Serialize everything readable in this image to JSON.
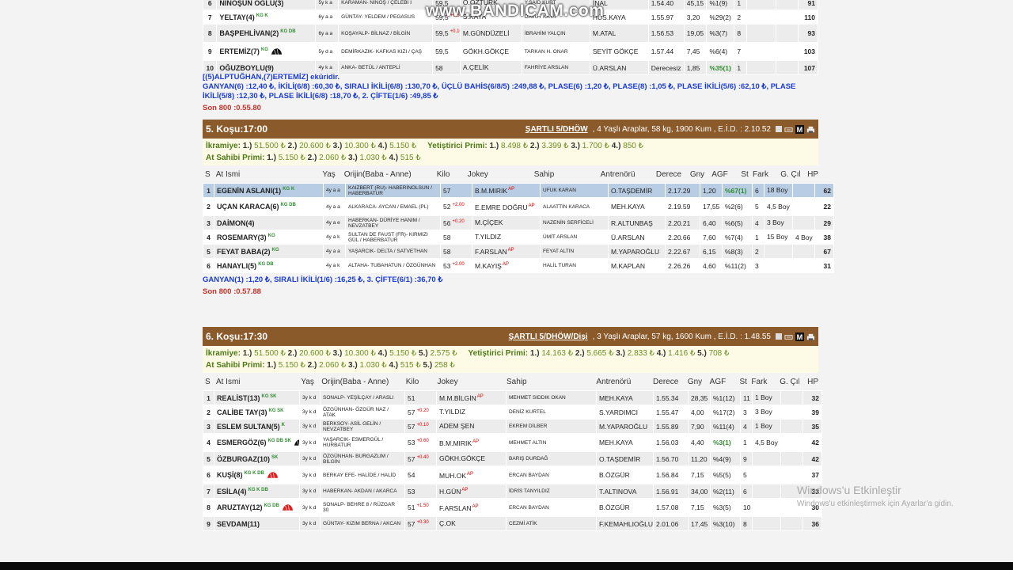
{
  "watermark": "www.BANDICAM.com",
  "race4": {
    "rows": [
      {
        "s": "6",
        "name": "NİNOŞUN OĞLU(3)",
        "badge": "",
        "age": "5y k a",
        "origin": "KARAMAN- NİNOŞ / ÇELEBİ I",
        "kilo": "59,5",
        "kd": "",
        "jockey": "O.ÖZTÜRK",
        "ap": "",
        "owner": "Y.SAİD KURT",
        "trainer": "İNAL",
        "derece": "1.54.40",
        "gny": "45,15",
        "agf": "%1(9)",
        "st": "1",
        "fark": "",
        "gck": "",
        "hp": "91",
        "gear": ""
      },
      {
        "s": "7",
        "name": "YELTAY(4)",
        "badge": "KG K",
        "age": "6y a a",
        "origin": "GÜNTAY- YELDEM / PEGASUS",
        "kilo": "59,5",
        "kd": "+0.60",
        "jockey": "S.KAYA",
        "ap": "",
        "owner": "DAVUT KAYA",
        "trainer": "HÜS.KAYA",
        "derece": "1.55.97",
        "gny": "3,20",
        "agf": "%29(2)",
        "st": "2",
        "fark": "",
        "gck": "",
        "hp": "110",
        "gear": ""
      },
      {
        "s": "8",
        "name": "BAŞPEHLİVAN(2)",
        "badge": "KG DB",
        "age": "6y a a",
        "origin": "KOŞAYALP- BİLNAZ / BİLGİN",
        "kilo": "59,5",
        "kd": "+0.10",
        "jockey": "M.GÜNDÜZELİ",
        "ap": "",
        "owner": "İBRAHİM YALÇIN",
        "trainer": "M.ATAL",
        "derece": "1.56.53",
        "gny": "19,05",
        "agf": "%3(7)",
        "st": "8",
        "fark": "",
        "gck": "",
        "hp": "93",
        "gear": ""
      },
      {
        "s": "9",
        "name": "ERTEMİZ(7)",
        "badge": "KG",
        "age": "5y d a",
        "origin": "DEMİRKAZIK- KAFKAS KIZI / ÇAŞ",
        "kilo": "59,5",
        "kd": "",
        "jockey": "GÖKH.GÖKÇE",
        "ap": "",
        "owner": "TARKAN H. ONAR",
        "trainer": "SEYİT GÖKÇE",
        "derece": "1.57.44",
        "gny": "7,45",
        "agf": "%6(4)",
        "st": "7",
        "fark": "",
        "gck": "",
        "hp": "103",
        "gear": "black"
      },
      {
        "s": "10",
        "name": "OĞUZBOYLU(9)",
        "badge": "",
        "age": "4y k a",
        "origin": "ANKA- BETÜL / ANTEPLİ",
        "kilo": "58",
        "kd": "",
        "jockey": "A.ÇELİK",
        "ap": "",
        "owner": "FAHRİYE ARSLAN",
        "trainer": "Ü.ARSLAN",
        "derece": "Derecesiz",
        "gny": "1,85",
        "agf": "%35(1)",
        "st": "1",
        "fark": "",
        "gck": "",
        "hp": "107",
        "gear": ""
      }
    ],
    "note": "[(5)ALPTUĞHAN,(7)ERTEMİZ] eküridir.",
    "payout": "GANYAN(6) :12,40 ₺, İKİLİ(6/8) :60,30 ₺, SIRALI İKİLİ(6/8) :130,70 ₺, ÜÇLÜ BAHİS(6/8/5) :249,88 ₺, PLASE(6) :1,20 ₺, PLASE(8) :1,05 ₺, PLASE İKİLİ(5/6) :62,10 ₺, PLASE İKİLİ(5/8) :12,30 ₺, PLASE İKİLİ(6/8) :18,70 ₺, 2. ÇİFTE(1/6) :49,85 ₺",
    "son800": "Son 800 :0.55.80"
  },
  "race5": {
    "title": "5. Koşu:17:00",
    "cond": "ŞARTLI 5/DHÖW",
    "desc": ", 4 Yaşlı Araplar, 58 kg, 1900 Kum , E.İ.D. : 2.10.52",
    "ikramiye_label": "İkramiye:",
    "ikramiye": [
      "1.) 51.500 ₺",
      "2.) 20.600 ₺",
      "3.) 10.300 ₺",
      "4.) 5.150 ₺"
    ],
    "yetistirici_label": "Yetiştirici Primi:",
    "yetistirici": [
      "1.) 8.498 ₺",
      "2.) 3.399 ₺",
      "3.) 1.700 ₺",
      "4.) 850 ₺"
    ],
    "atsahibi_label": "At Sahibi Primi:",
    "atsahibi": [
      "1.) 5.150 ₺",
      "2.) 2.060 ₺",
      "3.) 1.030 ₺",
      "4.) 515 ₺"
    ],
    "rows": [
      {
        "s": "1",
        "name": "EGENİN ASLANI(1)",
        "badge": "KG K",
        "age": "4y a a",
        "origin": "KAIZBERT (RU)- HABERİNOLSUN / HABERBATUR",
        "kilo": "57",
        "kd": "",
        "jockey": "B.M.MIRIK",
        "ap": "AP",
        "owner": "UFUK KARAN",
        "trainer": "O.TAŞDEMİR",
        "derece": "2.17.29",
        "gny": "1,20",
        "agf": "%67(1)",
        "st": "6",
        "fark": "18 Boy",
        "gck": "",
        "hp": "62",
        "gear": ""
      },
      {
        "s": "2",
        "name": "UÇAN KARACA(6)",
        "badge": "KG DB",
        "age": "4y a a",
        "origin": "ALKARACA- AYCAN / EMAEL (PL)",
        "kilo": "52",
        "kd": "+2.00",
        "jockey": "E.EMRE DOĞRU",
        "ap": "AP",
        "owner": "ALAATTİN KARACA",
        "trainer": "MEH.KAYA",
        "derece": "2.19.59",
        "gny": "17,55",
        "agf": "%2(6)",
        "st": "5",
        "fark": "4,5 Boy",
        "gck": "",
        "hp": "22",
        "gear": ""
      },
      {
        "s": "3",
        "name": "DAİMON(4)",
        "badge": "",
        "age": "4y a e",
        "origin": "HABERKAN- DÜRİYE HANIM / NEVZATBEY",
        "kilo": "56",
        "kd": "+0.20",
        "jockey": "M.ÇİÇEK",
        "ap": "",
        "owner": "NAZENİN SERFİCELİ",
        "trainer": "R.ALTUNBAŞ",
        "derece": "2.20.21",
        "gny": "6,40",
        "agf": "%6(5)",
        "st": "4",
        "fark": "3 Boy",
        "gck": "",
        "hp": "29",
        "gear": ""
      },
      {
        "s": "4",
        "name": "ROSEMARY(3)",
        "badge": "KG",
        "age": "4y a k",
        "origin": "SULTAN DE FAUST (FR)- KIRMIZI GÜL / HABERBATUR",
        "kilo": "58",
        "kd": "",
        "jockey": "T.YILDIZ",
        "ap": "",
        "owner": "ÜMİT ARSLAN",
        "trainer": "Ü.ARSLAN",
        "derece": "2.20.66",
        "gny": "7,60",
        "agf": "%7(4)",
        "st": "1",
        "fark": "15 Boy",
        "gck": "4 Boy",
        "hp": "38",
        "gear": ""
      },
      {
        "s": "5",
        "name": "FEYAT BABA(2)",
        "badge": "KG",
        "age": "4y a a",
        "origin": "YAŞARCIK- DELTA / SATVETHAN",
        "kilo": "58",
        "kd": "",
        "jockey": "F.ARSLAN",
        "ap": "AP",
        "owner": "FEYAT ALTIN",
        "trainer": "M.YAPAROĞLU",
        "derece": "2.22.67",
        "gny": "6,15",
        "agf": "%8(3)",
        "st": "2",
        "fark": "",
        "gck": "",
        "hp": "67",
        "gear": ""
      },
      {
        "s": "6",
        "name": "HANAYLI(5)",
        "badge": "KG DB",
        "age": "4y a k",
        "origin": "ALTAHA- TUBAHATUN / ÖZGÜNHAN",
        "kilo": "53",
        "kd": "+2.00",
        "jockey": "M.KAYIŞ",
        "ap": "AP",
        "owner": "HALİL TURAN",
        "trainer": "M.KAPLAN",
        "derece": "2.26.26",
        "gny": "4,60",
        "agf": "%11(2)",
        "st": "3",
        "fark": "",
        "gck": "",
        "hp": "31",
        "gear": ""
      }
    ],
    "payout": "GANYAN(1) :1,20 ₺, SIRALI İKİLİ(1/6) :16,25 ₺, 3. ÇİFTE(6/1) :36,70 ₺",
    "son800": "Son 800 :0.57.88"
  },
  "race6": {
    "title": "6. Koşu:17:30",
    "cond": "ŞARTLI 5/DHÖW/Dişi",
    "desc": ", 3 Yaşlı Araplar, 57 kg, 1600 Kum , E.İ.D. : 1.48.55",
    "ikramiye_label": "İkramiye:",
    "ikramiye": [
      "1.) 51.500 ₺",
      "2.) 20.600 ₺",
      "3.) 10.300 ₺",
      "4.) 5.150 ₺",
      "5.) 2.575 ₺"
    ],
    "yetistirici_label": "Yetiştirici Primi:",
    "yetistirici": [
      "1.) 14.163 ₺",
      "2.) 5.665 ₺",
      "3.) 2.833 ₺",
      "4.) 1.416 ₺",
      "5.) 708 ₺"
    ],
    "atsahibi_label": "At Sahibi Primi:",
    "atsahibi": [
      "1.) 5.150 ₺",
      "2.) 2.060 ₺",
      "3.) 1.030 ₺",
      "4.) 515 ₺",
      "5.) 258 ₺"
    ],
    "rows": [
      {
        "s": "1",
        "name": "REALİST(13)",
        "badge": "KG SK",
        "age": "3y k d",
        "origin": "SONALP- YEŞİLÇAY / ARASLI",
        "kilo": "51",
        "kd": "",
        "jockey": "M.M.BİLGİN",
        "ap": "AP",
        "owner": "MEHMET SIDDIK OKAN",
        "trainer": "MEH.KAYA",
        "derece": "1.55.34",
        "gny": "28,35",
        "agf": "%1(12)",
        "st": "11",
        "fark": "1 Boy",
        "gck": "",
        "hp": "32",
        "gear": ""
      },
      {
        "s": "2",
        "name": "CALİBE TAY(3)",
        "badge": "KG SK",
        "age": "3y k d",
        "origin": "ÖZGÜNHAN- ÖZGÜR NAZ / ATAK",
        "kilo": "57",
        "kd": "+0.20",
        "jockey": "T.YILDIZ",
        "ap": "",
        "owner": "DENİZ KURTEL",
        "trainer": "S.YARDIMCI",
        "derece": "1.55.47",
        "gny": "4,00",
        "agf": "%17(2)",
        "st": "3",
        "fark": "3 Boy",
        "gck": "",
        "hp": "39",
        "gear": ""
      },
      {
        "s": "3",
        "name": "ESLEM SULTAN(5)",
        "badge": "K",
        "age": "3y k d",
        "origin": "BERKSOY- ASİL GELİN / NEVZATBEY",
        "kilo": "57",
        "kd": "+0.10",
        "jockey": "ADEM ŞEN",
        "ap": "",
        "owner": "EKREM DİLBER",
        "trainer": "M.YAPAROĞLU",
        "derece": "1.55.89",
        "gny": "7,90",
        "agf": "%11(4)",
        "st": "4",
        "fark": "1 Boy",
        "gck": "",
        "hp": "35",
        "gear": ""
      },
      {
        "s": "4",
        "name": "ESMERGÖZ(6)",
        "badge": "KG DB SK",
        "age": "3y k d",
        "origin": "YAŞARCIK- ESMERGÜL / HURBATUR",
        "kilo": "53",
        "kd": "+0.60",
        "jockey": "B.M.MIRIK",
        "ap": "AP",
        "owner": "MEHMET ALTIN",
        "trainer": "MEH.KAYA",
        "derece": "1.56.03",
        "gny": "4,40",
        "agf": "%3(1)",
        "st": "1",
        "fark": "4,5 Boy",
        "gck": "",
        "hp": "42",
        "gear": "black"
      },
      {
        "s": "5",
        "name": "ÖZBURGAZ(10)",
        "badge": "SK",
        "age": "3y k d",
        "origin": "ÖZGÜNHAN- BURGAZLIM / BİLGİN",
        "kilo": "57",
        "kd": "+0.40",
        "jockey": "GÖKH.GÖKÇE",
        "ap": "",
        "owner": "BARIŞ DURDAĞ",
        "trainer": "O.TAŞDEMİR",
        "derece": "1.56.70",
        "gny": "11,20",
        "agf": "%4(9)",
        "st": "9",
        "fark": "",
        "gck": "",
        "hp": "42",
        "gear": ""
      },
      {
        "s": "6",
        "name": "KUŞİ(8)",
        "badge": "KG K DB",
        "age": "3y k d",
        "origin": "BERKAY EFE- HALİDE / HALİD",
        "kilo": "54",
        "kd": "",
        "jockey": "MUH.OK",
        "ap": "AP",
        "owner": "ERCAN BAYDAN",
        "trainer": "B.ÖZGÜR",
        "derece": "1.56.84",
        "gny": "7,15",
        "agf": "%5(5)",
        "st": "5",
        "fark": "",
        "gck": "",
        "hp": "37",
        "gear": "red"
      },
      {
        "s": "7",
        "name": "ESİLA(4)",
        "badge": "KG K DB",
        "age": "3y k d",
        "origin": "HABERKAN- AKDAN / AKARCA",
        "kilo": "53",
        "kd": "",
        "jockey": "H.GÜN",
        "ap": "AP",
        "owner": "İDRİS TANYILDIZ",
        "trainer": "T.ALTINOVA",
        "derece": "1.56.91",
        "gny": "34,00",
        "agf": "%2(11)",
        "st": "6",
        "fark": "",
        "gck": "",
        "hp": "33",
        "gear": ""
      },
      {
        "s": "8",
        "name": "ARUZTAY(12)",
        "badge": "KG DB",
        "age": "3y k d",
        "origin": "SONALP- BEHRE 8 / RÜZGAR 30",
        "kilo": "51",
        "kd": "+1.50",
        "jockey": "F.ARSLAN",
        "ap": "AP",
        "owner": "ERCAN BAYDAN",
        "trainer": "B.ÖZGÜR",
        "derece": "1.57.08",
        "gny": "7,15",
        "agf": "%3(5)",
        "st": "10",
        "fark": "",
        "gck": "",
        "hp": "30",
        "gear": "red"
      },
      {
        "s": "9",
        "name": "SEVDAM(11)",
        "badge": "",
        "age": "3y k d",
        "origin": "GÜNTAY- KIZIM BERNA / AKCAN",
        "kilo": "57",
        "kd": "+0.30",
        "jockey": "Ç.OK",
        "ap": "",
        "owner": "CEZMİ ATİK",
        "trainer": "F.KEMAHLIOĞLU",
        "derece": "2.01.06",
        "gny": "17,45",
        "agf": "%3(10)",
        "st": "8",
        "fark": "",
        "gck": "",
        "hp": "36",
        "gear": ""
      }
    ]
  },
  "columns": {
    "s": "S",
    "name": "At İsmi",
    "age": "Yaş",
    "origin": "Orijin(Baba - Anne)",
    "kilo": "Kilo",
    "jockey": "Jokey",
    "owner": "Sahip",
    "trainer": "Antrenörü",
    "derece": "Derece",
    "gny": "Gny",
    "agf": "AGF",
    "st": "St",
    "fark": "Fark",
    "gck": "G. Çık.",
    "hp": "HP"
  },
  "windows": {
    "activate_title": "Windows'u Etkinleştir",
    "activate_sub": "Windows'u etkinleştirmek için Ayarlar'a gidin."
  },
  "colors": {
    "header_brown": "#8b5a2b",
    "payout_blue": "#1a3bd6",
    "son_red": "#c0342b",
    "prize_green": "#5a7d1f",
    "highlight_row": "#b8cce4"
  }
}
